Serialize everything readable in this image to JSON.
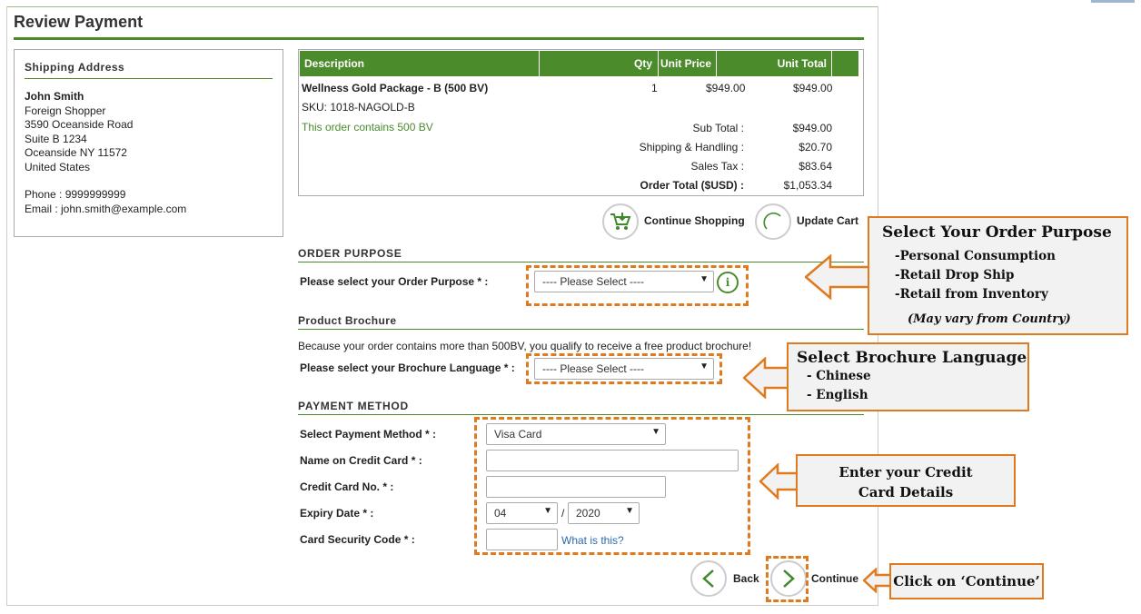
{
  "page": {
    "title": "Review Payment"
  },
  "shipping": {
    "heading": "Shipping Address",
    "name": "John Smith",
    "lines": [
      "Foreign Shopper",
      "3590 Oceanside Road",
      "Suite B 1234",
      "Oceanside NY 11572",
      "United States"
    ],
    "phone": "Phone : 9999999999",
    "email": "Email : john.smith@example.com"
  },
  "cart": {
    "headers": {
      "description": "Description",
      "qty": "Qty",
      "unit_price": "Unit Price",
      "unit_total": "Unit Total"
    },
    "item": {
      "name": "Wellness Gold Package - B (500 BV)",
      "sku": "SKU: 1018-NAGOLD-B",
      "qty": "1",
      "unit_price": "$949.00",
      "unit_total": "$949.00"
    },
    "bv_note": "This order contains 500 BV",
    "totals": [
      {
        "label": "Sub Total :",
        "value": "$949.00"
      },
      {
        "label": "Shipping & Handling :",
        "value": "$20.70"
      },
      {
        "label": "Sales Tax :",
        "value": "$83.64"
      },
      {
        "label": "Order Total ($USD) :",
        "value": "$1,053.34"
      }
    ],
    "continue_shopping": "Continue Shopping",
    "update_cart": "Update Cart"
  },
  "order_purpose": {
    "heading": "ORDER PURPOSE",
    "label": "Please select your Order Purpose * :",
    "selected": "---- Please Select ----"
  },
  "brochure": {
    "heading": "Product Brochure",
    "note": "Because your order contains more than 500BV, you qualify to receive a free product brochure!",
    "label": "Please select your Brochure Language * :",
    "selected": "---- Please Select ----"
  },
  "payment": {
    "heading": "PAYMENT METHOD",
    "method_label": "Select Payment Method * :",
    "method_value": "Visa Card",
    "name_label": "Name on Credit Card * :",
    "card_label": "Credit Card No. * :",
    "expiry_label": "Expiry Date * :",
    "expiry_month": "04",
    "expiry_sep": "/",
    "expiry_year": "2020",
    "cvc_label": "Card Security Code * :",
    "what_is_this": "What is this?"
  },
  "nav": {
    "back": "Back",
    "continue": "Continue"
  },
  "callouts": {
    "purpose": {
      "title": "Select Your Order Purpose",
      "items": [
        "-Personal Consumption",
        "-Retail Drop Ship",
        "-Retail from Inventory"
      ],
      "note": "(May vary from Country)"
    },
    "language": {
      "title": "Select Brochure Language",
      "items": [
        "- Chinese",
        "- English"
      ]
    },
    "card": {
      "line1": "Enter your Credit",
      "line2": "Card Details"
    },
    "continue": {
      "text": "Click on ‘Continue’"
    }
  },
  "colors": {
    "green": "#4c8b2b",
    "callout_orange": "#e07a1e",
    "link_blue": "#2a6ab0"
  }
}
